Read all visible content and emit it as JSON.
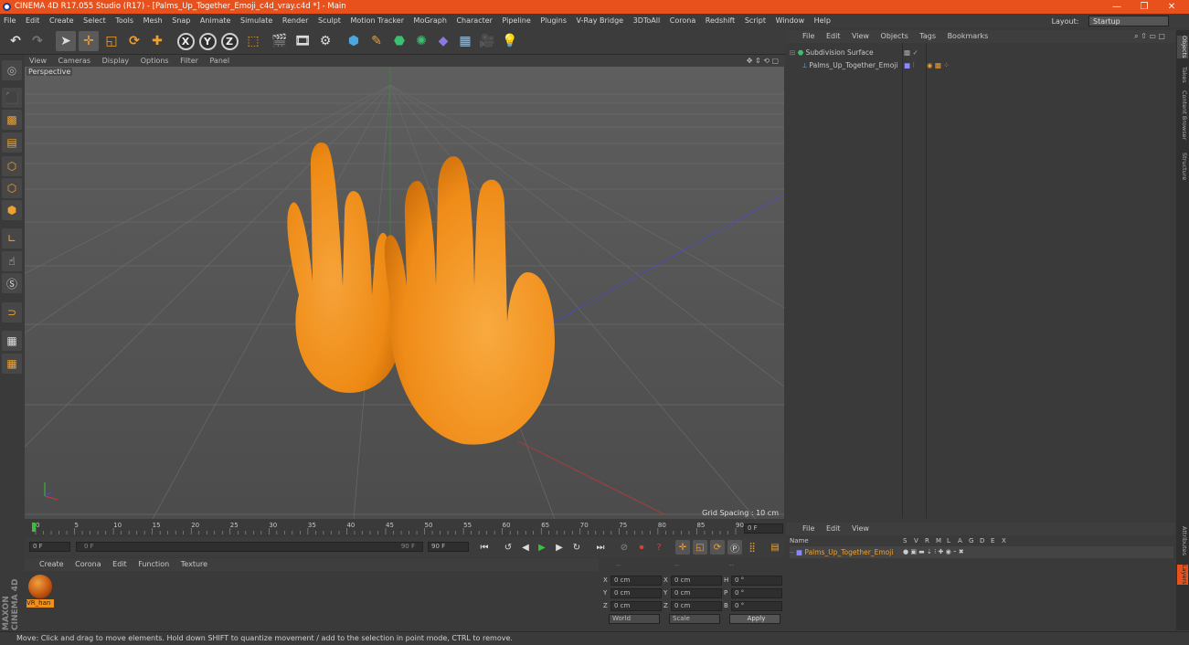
{
  "title_bar": {
    "title": "CINEMA 4D R17.055 Studio (R17) - [Palms_Up_Together_Emoji_c4d_vray.c4d *] - Main",
    "minimize": "—",
    "maximize": "❐",
    "close": "✕"
  },
  "menu": [
    "File",
    "Edit",
    "Create",
    "Select",
    "Tools",
    "Mesh",
    "Snap",
    "Animate",
    "Simulate",
    "Render",
    "Sculpt",
    "Motion Tracker",
    "MoGraph",
    "Character",
    "Pipeline",
    "Plugins",
    "V-Ray Bridge",
    "3DToAll",
    "Corona",
    "Redshift",
    "Script",
    "Window",
    "Help"
  ],
  "layout": {
    "label": "Layout:",
    "value": "Startup"
  },
  "axis_buttons": [
    "X",
    "Y",
    "Z"
  ],
  "viewport_menu": [
    "View",
    "Cameras",
    "Display",
    "Options",
    "Filter",
    "Panel"
  ],
  "viewport": {
    "label": "Perspective",
    "grid_spacing": "Grid Spacing : 10 cm"
  },
  "timeline": {
    "ticks": [
      "0",
      "5",
      "10",
      "15",
      "20",
      "25",
      "30",
      "35",
      "40",
      "45",
      "50",
      "55",
      "60",
      "65",
      "70",
      "75",
      "80",
      "85",
      "90"
    ],
    "frame_field": "0 F"
  },
  "transport": {
    "start": "0 F",
    "range_start": "0 F",
    "range_end": "90 F",
    "end": "90 F"
  },
  "material_menu": [
    "Create",
    "Corona",
    "Edit",
    "Function",
    "Texture"
  ],
  "material": {
    "name": "VR_han"
  },
  "coords": {
    "header": [
      "--",
      "--",
      "--"
    ],
    "rows": [
      {
        "a": "X",
        "av": "0 cm",
        "b": "X",
        "bv": "0 cm",
        "c": "H",
        "cv": "0 °"
      },
      {
        "a": "Y",
        "av": "0 cm",
        "b": "Y",
        "bv": "0 cm",
        "c": "P",
        "cv": "0 °"
      },
      {
        "a": "Z",
        "av": "0 cm",
        "b": "Z",
        "bv": "0 cm",
        "c": "B",
        "cv": "0 °"
      }
    ],
    "world": "World",
    "scale": "Scale",
    "apply": "Apply"
  },
  "object_menu": [
    "File",
    "Edit",
    "View",
    "Objects",
    "Tags",
    "Bookmarks"
  ],
  "objects": [
    {
      "name": "Subdivision Surface"
    },
    {
      "name": "Palms_Up_Together_Emoji"
    }
  ],
  "layer_menu": [
    "File",
    "Edit",
    "View"
  ],
  "layer_header": {
    "name": "Name",
    "cols": [
      "S",
      "V",
      "R",
      "M",
      "L",
      "A",
      "G",
      "D",
      "E",
      "X"
    ]
  },
  "layers": [
    {
      "name": "Palms_Up_Together_Emoji"
    }
  ],
  "right_tabs": [
    "Objects",
    "Takes",
    "Content Browser",
    "Structure",
    "Attributes",
    "Layers"
  ],
  "status": "Move: Click and drag to move elements. Hold down SHIFT to quantize movement / add to the selection in point mode, CTRL to remove.",
  "brand": "MAXON CINEMA 4D",
  "colors": {
    "title": "#e8501c",
    "hand": "#f0901c",
    "object_label": "#f0a030"
  }
}
